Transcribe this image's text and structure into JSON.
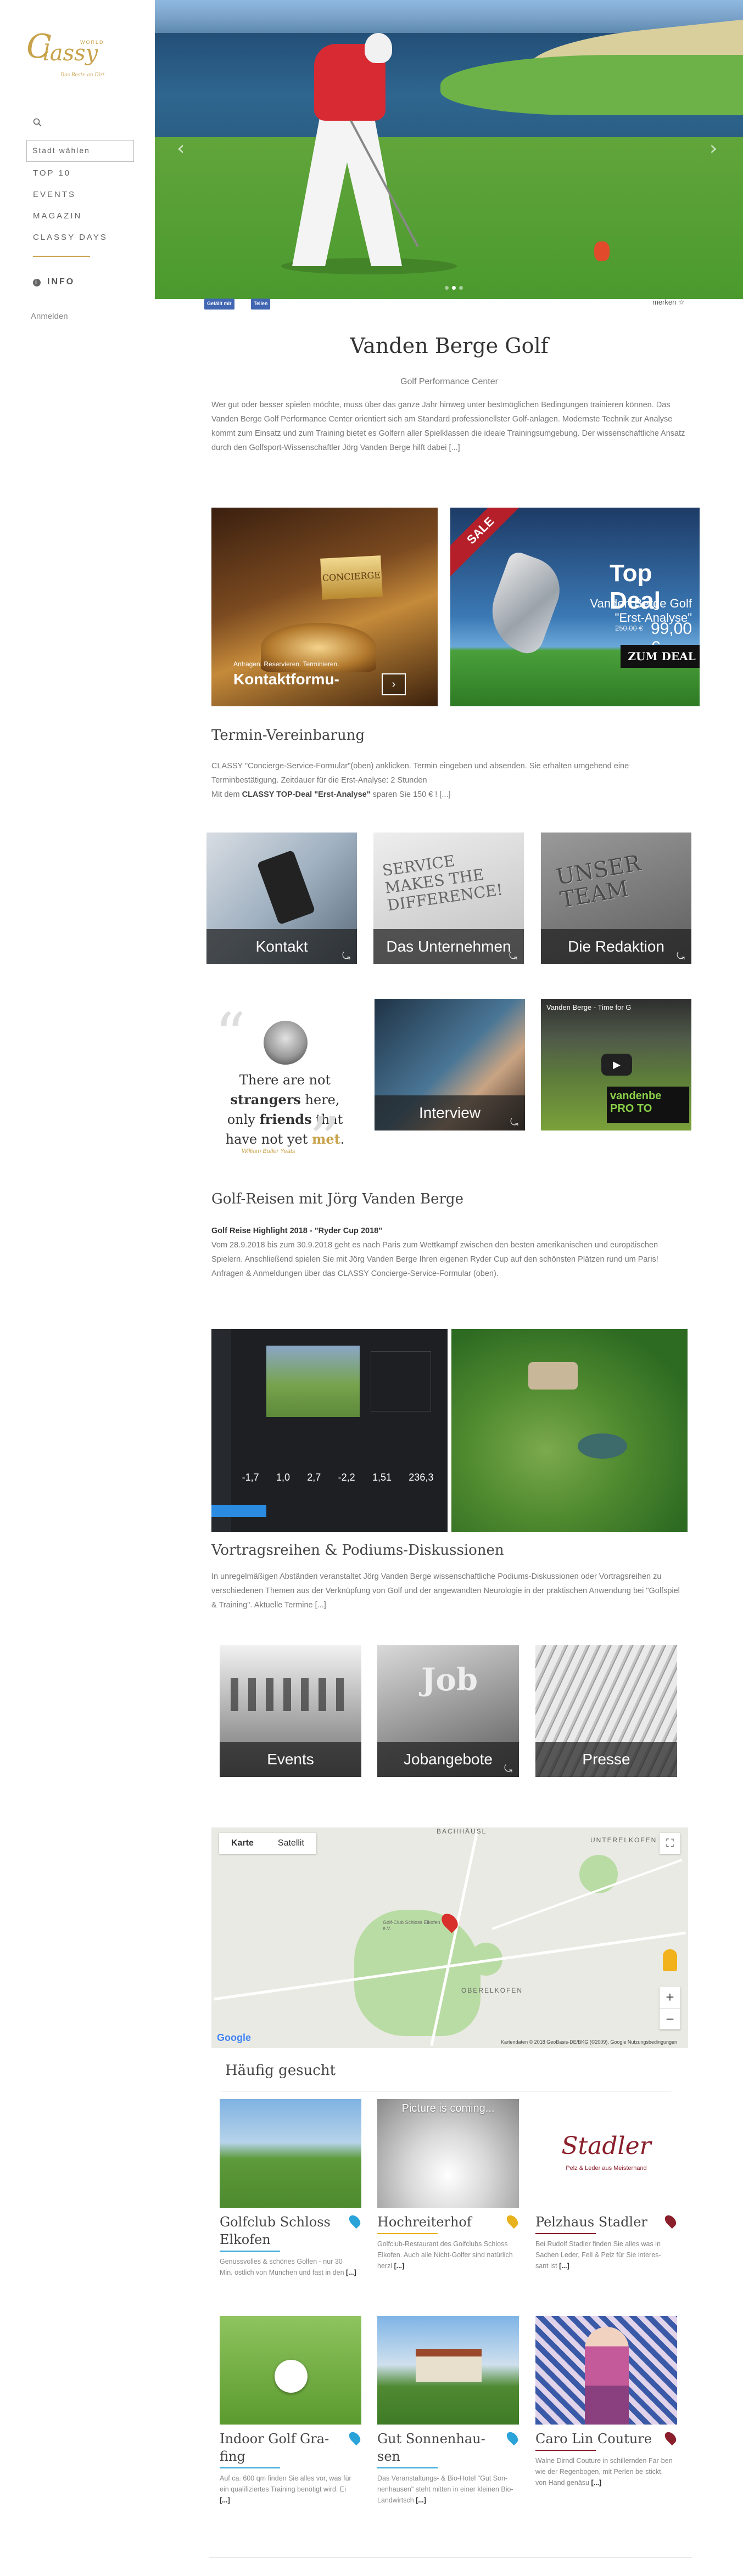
{
  "sidebar": {
    "logo": {
      "word1": "C",
      "word2": "lassy",
      "world": "WORLD",
      "tagline": "Das Beste an Dir!"
    },
    "city_select": "Stadt wählen",
    "nav": [
      "TOP 10",
      "EVENTS",
      "MAGAZIN",
      "CLASSY DAYS"
    ],
    "info": "INFO",
    "login": "Anmelden"
  },
  "hero": {
    "prev_arrow": "‹",
    "next_arrow": "›",
    "slide_count": 3,
    "active_slide": 1
  },
  "social": {
    "fb_like": "Gefällt mir",
    "fb_share": "Teilen",
    "bookmark": "merken ☆"
  },
  "page": {
    "title": "Vanden Berge Golf",
    "subtitle": "Golf Performance Center",
    "intro": "Wer gut oder besser spielen möchte, muss über das ganze Jahr hinweg unter bestmöglichen Bedingungen trainieren können. Das Vanden Berge Golf Performance Center orientiert sich am Standard professionellster Golf-anlagen. Modernste Technik zur Analyse kommt zum Einsatz und zum Training bietet es Golfern aller Spielklassen die ideale Trainingsumgebung. Der wissenschaftliche Ansatz durch den Golfsport-Wissenschaftler Jörg Vanden Berge hilft dabei [...]"
  },
  "promo": {
    "concierge": {
      "sign": "CONCIERGE",
      "line1": "Anfragen. Reservieren. Terminieren.",
      "line2": "Kontaktformu-",
      "go": "›"
    },
    "deal": {
      "ribbon": "SALE",
      "title": "Top Deal",
      "product": "Vanden Berge Golf \"Erst-Analyse\"",
      "old_price": "250,00 €",
      "new_price": "99,00 €",
      "button": "ZUM DEAL"
    }
  },
  "termin": {
    "heading": "Termin-Vereinbarung",
    "text1": "CLASSY \"Concierge-Service-Formular\"(oben) anklicken. Termin eingeben und absenden. Sie erhalten umgehend eine Terminbestätigung. Zeitdauer für die Erst-Analyse: 2 Stunden",
    "text2_prefix": "Mit dem ",
    "text2_bold": "CLASSY TOP-Deal \"Erst-Analyse\"",
    "text2_suffix": " sparen Sie 150 € ! [...]"
  },
  "tiles_row1": [
    "Kontakt",
    "Das Unternehmen",
    "Die Redaktion"
  ],
  "tile_art": {
    "service": "SERVICE MAKES THE DIFFERENCE!",
    "redaktion": "UNSER TEAM",
    "video_title": "Vanden Berge - Time for G",
    "video_brand": "vandenbe PRO TO",
    "job": "Job"
  },
  "quote": {
    "open": "“",
    "close": "”",
    "line1": "There are not",
    "line2": "strangers",
    "line2b": " here,",
    "line3a": "only ",
    "line3": "friends",
    "line3b": " that",
    "line4a": "have not yet ",
    "line4": "met",
    "line4b": ".",
    "author": "William Butler Yeats"
  },
  "tiles_row2": [
    "Interview"
  ],
  "reisen": {
    "heading": "Golf-Reisen mit Jörg Vanden Berge",
    "highlight": "Golf Reise Highlight 2018 - \"Ryder Cup 2018\"",
    "text": "Vom 28.9.2018 bis zum 30.9.2018 geht es nach Paris zum Wettkampf zwischen den besten amerikanischen und europäischen Spielern. Anschließend spielen Sie mit Jörg Vanden Berge Ihren eigenen Ryder Cup auf den schönsten Plätzen rund um Paris! Anfragen & Anmeldungen über das CLASSY Concierge-Service-Formular (oben)."
  },
  "stats": [
    "-1,7",
    "1,0",
    "2,7",
    "-2,2",
    "1,51",
    "236,3"
  ],
  "vortrag": {
    "heading": "Vortragsreihen & Podiums-Diskussionen",
    "text": "In unregelmäßigen Abständen veranstaltet Jörg Vanden Berge wissenschaftliche Podiums-Diskussionen oder Vortragsreihen zu verschiedenen Themen aus der Verknüpfung von Golf und der angewandten Neurologie in der praktischen Anwendung bei \"Golfspiel & Training\". Aktuelle Termine [...]"
  },
  "tiles_row3": [
    "Events",
    "Jobangebote",
    "Presse"
  ],
  "map": {
    "tab_map": "Karte",
    "tab_sat": "Satellit",
    "labels": [
      "BACHHÄUSL",
      "UNTERELKOFEN",
      "OBERELKOFEN",
      "Golf-Club Schloss Elkofen e.V."
    ],
    "credits": "Kartendaten © 2018 GeoBasis-DE/BKG (©2009), Google    Nutzungsbedingungen",
    "logo": "Google",
    "zoom_in": "+",
    "zoom_out": "−",
    "fullscreen": "⛶"
  },
  "frequent": {
    "heading": "Häufig gesucht",
    "items": [
      {
        "name": "Golfclub Schloss Elkofen",
        "desc": "Genussvolles & schönes Golfen - nur 30 Min. östlich von München und fast in den ",
        "more": "[...]",
        "color": "#2aa3d8",
        "img_text": ""
      },
      {
        "name": "Hochreiterhof",
        "desc": "Golfclub-Restaurant des Golfclubs Schloss Elkofen. Auch alle Nicht-Golfer sind natürlich herzl ",
        "more": "[...]",
        "color": "#e8b21c",
        "img_text": "Picture is coming..."
      },
      {
        "name": "Pelzhaus Stadler",
        "desc": "Bei Rudolf Stadler finden Sie alles was in Sachen Leder, Fell & Pelz für Sie interes-sant ist ",
        "more": "[...]",
        "color": "#8a1f2b",
        "img_text": "Stadler"
      },
      {
        "name": "Indoor Golf Gra-fing",
        "desc": "Auf ca. 600 qm finden Sie alles vor, was für ein qualifiziertes Training benötigt wird. Ei ",
        "more": "[...]",
        "color": "#2aa3d8",
        "img_text": ""
      },
      {
        "name": "Gut Sonnenhau-sen",
        "desc": "Das Veranstaltungs- & Bio-Hotel \"Gut Son-nenhausen\" steht mitten in einer kleinen Bio-Landwirtsch ",
        "more": "[...]",
        "color": "#2aa3d8",
        "img_text": ""
      },
      {
        "name": "Caro Lin Couture",
        "desc": "Walne Dirndl Couture in schillernden Far-ben wie der Regenbogen, mit Perlen be-stickt, von Hand genäsu ",
        "more": "[...]",
        "color": "#8a1f2b",
        "img_text": ""
      }
    ],
    "stadler_sub": "Pelz & Leder aus Meisterhand"
  }
}
